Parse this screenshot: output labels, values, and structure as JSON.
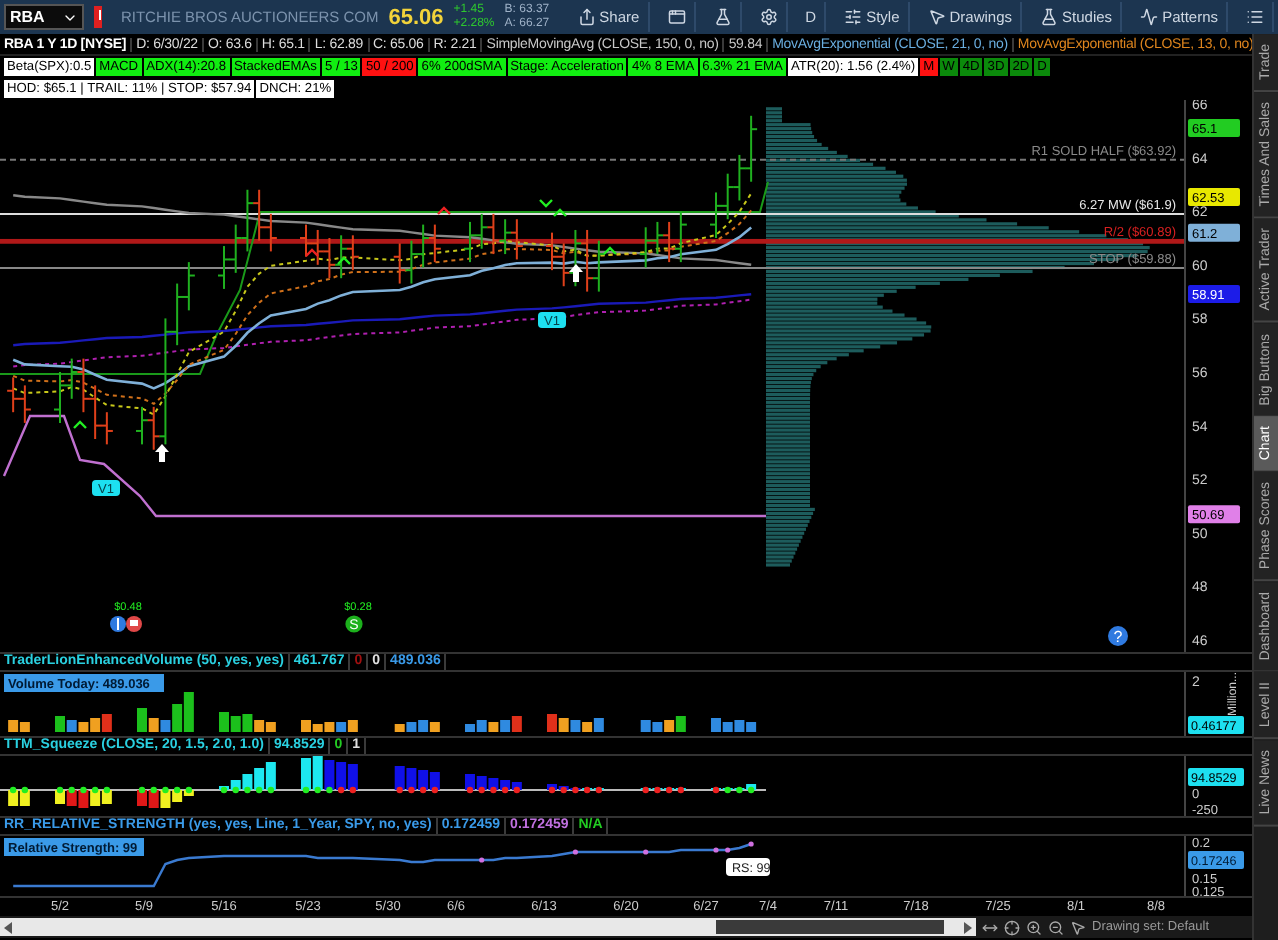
{
  "toolbar": {
    "symbol": "RBA",
    "company": "RITCHIE BROS AUCTIONEERS COM",
    "last": "65.06",
    "change": "+1.45",
    "change_pct": "+2.28%",
    "bid": "B: 63.37",
    "ask": "A: 66.27",
    "buttons": [
      {
        "kind": "share",
        "label": "Share"
      },
      {
        "kind": "window"
      },
      {
        "kind": "flask"
      },
      {
        "kind": "gear"
      },
      {
        "kind": "text",
        "label": "D"
      },
      {
        "kind": "style",
        "label": "Style"
      },
      {
        "kind": "drawings",
        "label": "Drawings"
      },
      {
        "kind": "studies",
        "label": "Studies"
      },
      {
        "kind": "patterns",
        "label": "Patterns"
      },
      {
        "kind": "menu"
      }
    ]
  },
  "header": {
    "title": "RBA 1 Y 1D [NYSE]",
    "fields": [
      "D: 6/30/22",
      "O: 63.6",
      "H: 65.1",
      "L: 62.89",
      "C: 65.06",
      "R: 2.21"
    ],
    "studies": [
      {
        "text": "SimpleMovingAvg (CLOSE, 150, 0, no)",
        "color": "#c8c8c8"
      },
      {
        "text": "59.84",
        "color": "#c8c8c8"
      },
      {
        "text": "MovAvgExponential (CLOSE, 21, 0, no)",
        "color": "#6aaee0"
      },
      {
        "text": "MovAvgExponential (CLOSE, 13, 0, no)",
        "color": "#e0861e"
      }
    ]
  },
  "labels": [
    {
      "text": "Beta(SPX):0.5",
      "color": "#ffffff"
    },
    {
      "text": "MACD",
      "color": "#11ee11"
    },
    {
      "text": "ADX(14):20.8",
      "color": "#11ee11"
    },
    {
      "text": "StackedEMAs",
      "color": "#11ee11"
    },
    {
      "text": "5 / 13",
      "color": "#11ee11"
    },
    {
      "text": "50 / 200",
      "color": "#ff1111"
    },
    {
      "text": "6% 200dSMA",
      "color": "#11ee11"
    },
    {
      "text": "Stage: Acceleration",
      "color": "#11ee11"
    },
    {
      "text": "4% 8 EMA",
      "color": "#11ee11"
    },
    {
      "text": "6.3% 21 EMA",
      "color": "#11ee11"
    },
    {
      "text": "ATR(20): 1.56 (2.4%)",
      "color": "#ffffff"
    },
    {
      "text": "M",
      "color": "#ff1111"
    },
    {
      "text": "W",
      "color": "#0b8a0b"
    },
    {
      "text": "4D",
      "color": "#0b8a0b"
    },
    {
      "text": "3D",
      "color": "#0b8a0b"
    },
    {
      "text": "2D",
      "color": "#0b8a0b"
    },
    {
      "text": "D",
      "color": "#0b8a0b"
    }
  ],
  "hod_labels": [
    "HOD: $65.1 | TRAIL: 11% | STOP: $57.94",
    "DNCH: 21%"
  ],
  "chart": {
    "price_ticks": [
      "66",
      "64",
      "62",
      "60",
      "58",
      "56",
      "54",
      "52",
      "50",
      "48",
      "46"
    ],
    "price_badges": [
      {
        "text": "65.1",
        "color": "#22cc22"
      },
      {
        "text": "62.53",
        "color": "#e8e800"
      },
      {
        "text": "61.2",
        "color": "#7fb0d8"
      },
      {
        "text": "58.91",
        "color": "#1c1ce8"
      },
      {
        "text": "50.69",
        "color": "#e080e8"
      }
    ],
    "line_labels": [
      {
        "text": "R1 SOLD HALF ($63.92)",
        "color": "#8a8a8a"
      },
      {
        "text": "6.27 MW ($61.9)",
        "color": "#e8e8e8"
      },
      {
        "text": "R/2 ($60.89)",
        "color": "#d82020"
      },
      {
        "text": "STOP ($59.88)",
        "color": "#8a8a8a"
      }
    ],
    "signals": [
      "V1",
      "V1"
    ],
    "events": [
      {
        "kind": "pair",
        "amount": "$0.48"
      },
      {
        "kind": "letter",
        "amount": "$0.28",
        "letter": "S"
      }
    ],
    "help": "?"
  },
  "panels": [
    {
      "kind": "volume",
      "title": "TraderLionEnhancedVolume (50, yes, yes)",
      "color": "#2ad0e0",
      "values": [
        "461.767",
        "0",
        "0",
        "489.036"
      ],
      "badge": "Volume Today: 489.036",
      "ticks": [
        "2"
      ],
      "reading": "0.46177",
      "unit": "Million..."
    },
    {
      "kind": "squeeze",
      "title": "TTM_Squeeze (CLOSE, 20, 1.5, 2.0, 1.0)",
      "color": "#2ad0e0",
      "values": [
        "94.8529",
        "0",
        "1"
      ],
      "ticks": [
        "0",
        "-250"
      ],
      "reading": "94.8529"
    },
    {
      "kind": "strength",
      "title": "RR_RELATIVE_STRENGTH (yes, yes, Line, 1_Year, SPY, no, yes)",
      "color": "#3a9ae8",
      "values": [
        "0.172459",
        "0.172459",
        "N/A"
      ],
      "badge": "Relative Strength: 99",
      "callout": "RS: 99",
      "ticks": [
        "0.2",
        "0.15",
        "0.125"
      ],
      "reading": "0.17246"
    }
  ],
  "x_ticks": [
    "5/2",
    "5/9",
    "5/16",
    "5/23",
    "5/30",
    "6/6",
    "6/13",
    "6/20",
    "6/27",
    "7/4",
    "7/11",
    "7/18",
    "7/25",
    "8/1",
    "8/8"
  ],
  "sidebar": [
    {
      "label": "Trade",
      "selected": false
    },
    {
      "label": "Times And Sales",
      "selected": false
    },
    {
      "label": "Active Trader",
      "selected": false
    },
    {
      "label": "Big Buttons",
      "selected": false
    },
    {
      "label": "Chart",
      "selected": true
    },
    {
      "label": "Phase Scores",
      "selected": false
    },
    {
      "label": "Dashboard",
      "selected": false
    },
    {
      "label": "Level II",
      "selected": false
    },
    {
      "label": "Live News",
      "selected": false
    }
  ],
  "status": {
    "drawing_set": "Drawing set: Default"
  }
}
